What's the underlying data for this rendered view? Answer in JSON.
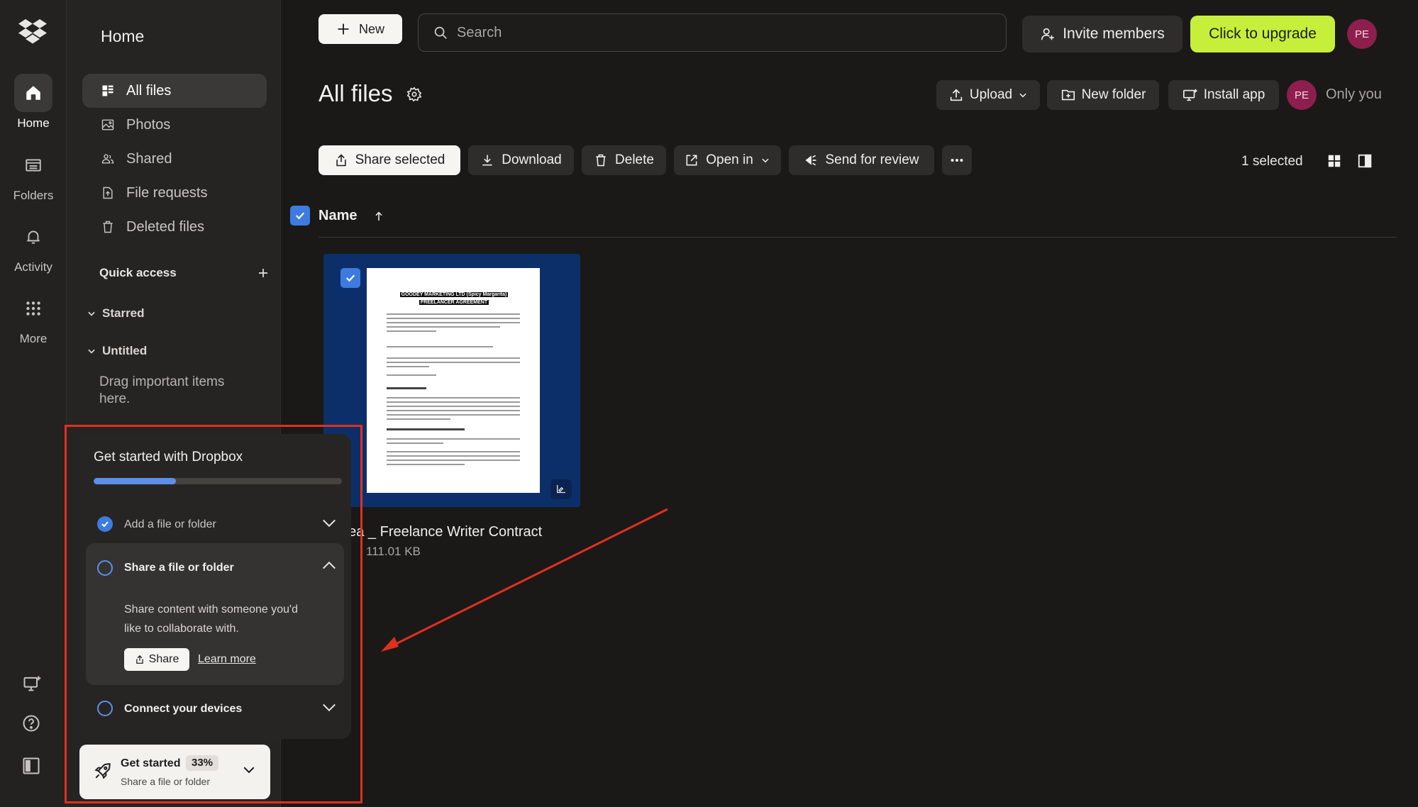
{
  "rail": {
    "items": [
      {
        "label": "Home"
      },
      {
        "label": "Folders"
      },
      {
        "label": "Activity"
      },
      {
        "label": "More"
      }
    ]
  },
  "sidebar": {
    "title": "Home",
    "nav": [
      {
        "label": "All files"
      },
      {
        "label": "Photos"
      },
      {
        "label": "Shared"
      },
      {
        "label": "File requests"
      },
      {
        "label": "Deleted files"
      }
    ],
    "quick_access": "Quick access",
    "folders": [
      {
        "label": "Starred"
      },
      {
        "label": "Untitled"
      }
    ],
    "drag_hint": "Drag important items here."
  },
  "topbar": {
    "new_label": "New",
    "search_placeholder": "Search",
    "invite_label": "Invite members",
    "upgrade_label": "Click to upgrade",
    "avatar_initials": "PE"
  },
  "header": {
    "title": "All files",
    "upload_label": "Upload",
    "new_folder_label": "New folder",
    "install_app_label": "Install app",
    "avatar_initials": "PE",
    "visibility": "Only you"
  },
  "toolbar": {
    "share_selected": "Share selected",
    "download": "Download",
    "delete": "Delete",
    "open_in": "Open in",
    "send_for_review": "Send for review",
    "selected_count": "1 selected"
  },
  "list": {
    "name_header": "Name"
  },
  "file": {
    "name": "nea _ Freelance Writer Contract",
    "size": "111.01 KB",
    "doc_title_line1": "GOODEY MARKETING LTD (Spicy Margarita)",
    "doc_title_line2": "FREELANCER AGREEMENT"
  },
  "onboarding": {
    "title": "Get started with Dropbox",
    "progress": 0.33,
    "steps": [
      {
        "label": "Add a file or folder",
        "done": true
      },
      {
        "label": "Share a file or folder",
        "done": false
      },
      {
        "label": "Connect your devices",
        "done": false
      }
    ],
    "open_step_desc": "Share content with someone you'd like to collaborate with.",
    "share_label": "Share",
    "learn_more_label": "Learn more"
  },
  "get_started": {
    "title": "Get started",
    "percent": "33%",
    "subtitle": "Share a file or folder"
  },
  "colors": {
    "accent_blue": "#3d7be0",
    "upgrade_green": "#c6ef3c",
    "avatar": "#8e1e4e",
    "annotation_red": "#e0301e",
    "thumb_bg": "#0d2f69"
  }
}
